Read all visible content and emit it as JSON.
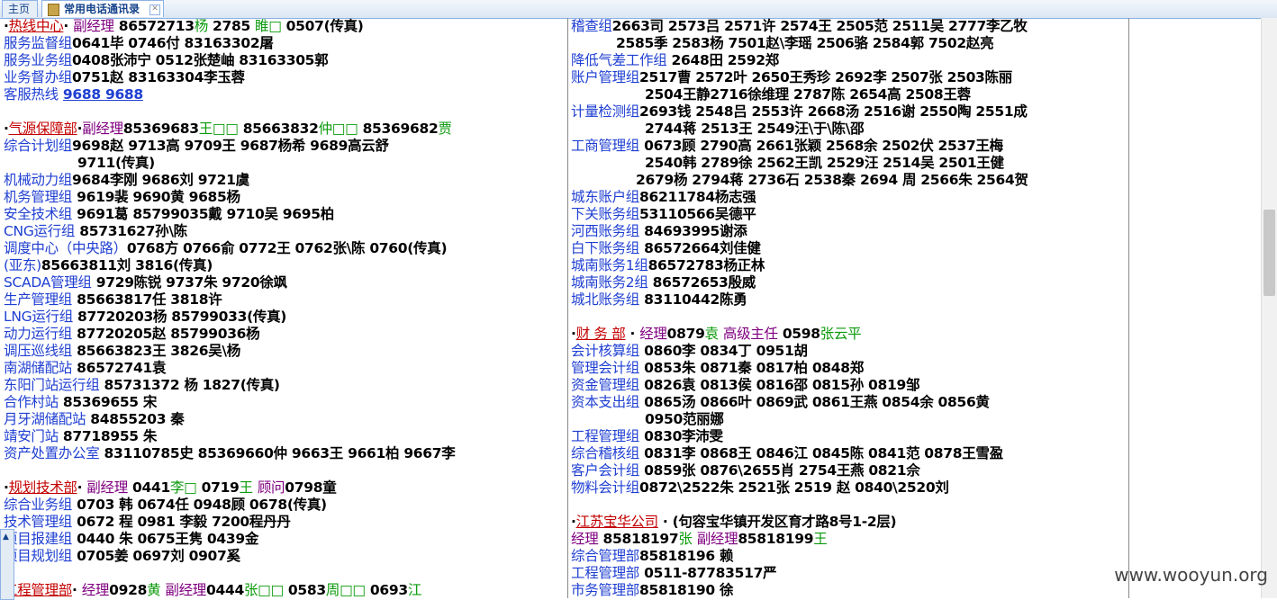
{
  "tabs": {
    "home": "主页",
    "active": "常用电话通讯录"
  },
  "left": [
    {
      "parts": [
        [
          "t",
          "·"
        ],
        [
          "sec",
          "热线中心"
        ],
        [
          "t",
          "·  "
        ],
        [
          "role",
          "副经理"
        ],
        [
          "t",
          " 86572713"
        ],
        [
          "g",
          "杨"
        ],
        [
          "t",
          "  2785 "
        ],
        [
          "g",
          "睢□"
        ],
        [
          "t",
          " 0507(传真)"
        ]
      ]
    },
    {
      "parts": [
        [
          "lbl",
          "服务监督组"
        ],
        [
          "t",
          "0641毕 0746付 83163302屠"
        ]
      ]
    },
    {
      "parts": [
        [
          "lbl",
          "服务业务组"
        ],
        [
          "t",
          "0408张沛宁 0512张楚岫  83163305郭"
        ]
      ]
    },
    {
      "parts": [
        [
          "lbl",
          "业务督办组"
        ],
        [
          "t",
          "0751赵  83163304李玉蓉"
        ]
      ]
    },
    {
      "parts": [
        [
          "lbl",
          "客服热线"
        ],
        [
          "t",
          "  "
        ],
        [
          "hl",
          "9688 9688"
        ]
      ]
    },
    {
      "gap": true
    },
    {
      "parts": [
        [
          "t",
          "·"
        ],
        [
          "sec",
          "气源保障部"
        ],
        [
          "t",
          "·"
        ],
        [
          "role",
          "副经理"
        ],
        [
          "t",
          "85369683"
        ],
        [
          "g",
          "王□□"
        ],
        [
          "t",
          " 85663832"
        ],
        [
          "g",
          "仲□□"
        ],
        [
          "t",
          " 85369682"
        ],
        [
          "g",
          "贾"
        ]
      ]
    },
    {
      "parts": [
        [
          "lbl",
          "综合计划组"
        ],
        [
          "t",
          "9698赵 9713高 9709王 9687杨希 9689高云舒"
        ]
      ]
    },
    {
      "indent": 1,
      "parts": [
        [
          "t",
          "9711(传真)"
        ]
      ]
    },
    {
      "parts": [
        [
          "lbl",
          "机械动力组"
        ],
        [
          "t",
          "9684李刚 9686刘 9721虞"
        ]
      ]
    },
    {
      "parts": [
        [
          "lbl",
          "机务管理组"
        ],
        [
          "t",
          " 9619裴 9690黄   9685杨"
        ]
      ]
    },
    {
      "parts": [
        [
          "lbl",
          "安全技术组"
        ],
        [
          "t",
          " 9691葛 85799035戴 9710吴 9695柏"
        ]
      ]
    },
    {
      "parts": [
        [
          "lbl",
          "CNG运行组"
        ],
        [
          "t",
          " 85731627孙\\陈"
        ]
      ]
    },
    {
      "parts": [
        [
          "lbl",
          "调度中心（中央路）"
        ],
        [
          "t",
          "0768方 0766俞 0772王 0762张\\陈  0760(传真)"
        ]
      ]
    },
    {
      "parts": [
        [
          "lbl",
          "(亚东)"
        ],
        [
          "t",
          "85663811刘 3816(传真)"
        ]
      ]
    },
    {
      "parts": [
        [
          "lbl",
          "SCADA管理组"
        ],
        [
          "t",
          " 9729陈锐 9737朱 9720徐飒"
        ]
      ]
    },
    {
      "parts": [
        [
          "lbl",
          "生产管理组"
        ],
        [
          "t",
          " 85663817任 3818许"
        ]
      ]
    },
    {
      "parts": [
        [
          "lbl",
          "LNG运行组"
        ],
        [
          "t",
          " 87720203杨 85799033(传真)"
        ]
      ]
    },
    {
      "parts": [
        [
          "lbl",
          "动力运行组"
        ],
        [
          "t",
          " 87720205赵 85799036杨"
        ]
      ]
    },
    {
      "parts": [
        [
          "lbl",
          "调压巡线组"
        ],
        [
          "t",
          " 85663823王 3826吴\\杨"
        ]
      ]
    },
    {
      "parts": [
        [
          "lbl",
          "南湖储配站"
        ],
        [
          "t",
          " 86572741袁"
        ]
      ]
    },
    {
      "parts": [
        [
          "lbl",
          "东阳门站运行组"
        ],
        [
          "t",
          " 85731372 杨 1827(传真)"
        ]
      ]
    },
    {
      "parts": [
        [
          "lbl",
          "合作村站"
        ],
        [
          "t",
          " 85369655 宋"
        ]
      ]
    },
    {
      "parts": [
        [
          "lbl",
          "月牙湖储配站"
        ],
        [
          "t",
          " 84855203 秦"
        ]
      ]
    },
    {
      "parts": [
        [
          "lbl",
          "靖安门站"
        ],
        [
          "t",
          " 87718955 朱"
        ]
      ]
    },
    {
      "parts": [
        [
          "lbl",
          "资产处置办公室"
        ],
        [
          "t",
          " 83110785史 85369660仲 9663王 9661柏 9667李"
        ]
      ]
    },
    {
      "gap": true
    },
    {
      "parts": [
        [
          "t",
          "·"
        ],
        [
          "sec",
          "规划技术部"
        ],
        [
          "t",
          "·    "
        ],
        [
          "role",
          "副经理"
        ],
        [
          "t",
          " 0441"
        ],
        [
          "g",
          "李□"
        ],
        [
          "t",
          "  0719"
        ],
        [
          "g",
          "王"
        ],
        [
          "t",
          "   "
        ],
        [
          "role",
          "顾问"
        ],
        [
          "t",
          "0798童"
        ]
      ]
    },
    {
      "parts": [
        [
          "lbl",
          "综合业务组"
        ],
        [
          "t",
          " 0703 韩  0674任 0948顾  0678(传真)"
        ]
      ]
    },
    {
      "parts": [
        [
          "lbl",
          "技术管理组"
        ],
        [
          "t",
          " 0672 程  0981 李毅  7200程丹丹"
        ]
      ]
    },
    {
      "parts": [
        [
          "lbl",
          "项目报建组"
        ],
        [
          "t",
          "  0440 朱  0675王隽  0439金"
        ]
      ]
    },
    {
      "parts": [
        [
          "lbl",
          "项目规划组"
        ],
        [
          "t",
          " 0705姜  0697刘  0907奚"
        ]
      ]
    },
    {
      "gap": true
    },
    {
      "parts": [
        [
          "sec",
          "工程管理部"
        ],
        [
          "t",
          "· "
        ],
        [
          "role",
          "经理"
        ],
        [
          "t",
          "0928"
        ],
        [
          "g",
          "黄"
        ],
        [
          "t",
          "  "
        ],
        [
          "role",
          "副经理"
        ],
        [
          "t",
          "0444"
        ],
        [
          "g",
          "张□□"
        ],
        [
          "t",
          " 0583"
        ],
        [
          "g",
          "周□□"
        ],
        [
          "t",
          " 0693"
        ],
        [
          "g",
          "江"
        ]
      ]
    }
  ],
  "right": [
    {
      "parts": [
        [
          "lbl",
          "稽查组"
        ],
        [
          "t",
          "2663司 2573吕 2571许 2574王  2505范  2511吴  2777李乙牧"
        ]
      ]
    },
    {
      "indent": 2,
      "parts": [
        [
          "t",
          "2585季  2583杨 7501赵\\李瑶  2506骆  2584郭  7502赵亮"
        ]
      ]
    },
    {
      "parts": [
        [
          "lbl",
          "降低气差工作组"
        ],
        [
          "t",
          " 2648田  2592郑"
        ]
      ]
    },
    {
      "parts": [
        [
          "lbl",
          "账户管理组"
        ],
        [
          "t",
          "2517曹 2572叶 2650王秀珍  2692李 2507张 2503陈丽"
        ]
      ]
    },
    {
      "indent": 1,
      "parts": [
        [
          "t",
          "2504王静2716徐维理  2787陈  2654高  2508王蓉"
        ]
      ]
    },
    {
      "parts": [
        [
          "lbl",
          "计量检测组"
        ],
        [
          "t",
          "2693钱 2548吕 2553许  2668汤  2516谢 2550陶  2551成"
        ]
      ]
    },
    {
      "indent": 1,
      "parts": [
        [
          "t",
          "2744蒋  2513王  2549汪\\于\\陈\\邵"
        ]
      ]
    },
    {
      "parts": [
        [
          "lbl",
          "工商管理组"
        ],
        [
          "t",
          " 0673顾 2790高 2661张颖 2568余 2502伏 2537王梅"
        ]
      ]
    },
    {
      "indent": 1,
      "parts": [
        [
          "t",
          "2540韩  2789徐  2562王凯  2529汪  2514吴 2501王健"
        ]
      ]
    },
    {
      "indent": 3,
      "parts": [
        [
          "t",
          "2679杨  2794蒋  2736石  2538秦  2694 周 2566朱  2564贺"
        ]
      ]
    },
    {
      "parts": [
        [
          "lbl",
          "城东账户组"
        ],
        [
          "t",
          "86211784杨志强"
        ]
      ]
    },
    {
      "parts": [
        [
          "lbl",
          "下关账务组"
        ],
        [
          "t",
          "53110566吴德平"
        ]
      ]
    },
    {
      "parts": [
        [
          "lbl",
          "河西账务组"
        ],
        [
          "t",
          "  84693995谢添"
        ]
      ]
    },
    {
      "parts": [
        [
          "lbl",
          "白下账务组"
        ],
        [
          "t",
          "  86572664刘佳健"
        ]
      ]
    },
    {
      "parts": [
        [
          "lbl",
          "城南账务1组"
        ],
        [
          "t",
          "86572783杨正林"
        ]
      ]
    },
    {
      "parts": [
        [
          "lbl",
          "城南账务2组"
        ],
        [
          "t",
          "  86572653殷威"
        ]
      ]
    },
    {
      "parts": [
        [
          "lbl",
          "城北账务组"
        ],
        [
          "t",
          "  83110442陈勇"
        ]
      ]
    },
    {
      "gap": true
    },
    {
      "parts": [
        [
          "t",
          " ·"
        ],
        [
          "sec",
          "财 务 部"
        ],
        [
          "t",
          " · "
        ],
        [
          "role",
          "经理"
        ],
        [
          "t",
          "0879"
        ],
        [
          "g",
          "袁"
        ],
        [
          "t",
          "  "
        ],
        [
          "role",
          "高级主任"
        ],
        [
          "t",
          " 0598"
        ],
        [
          "g",
          "张云平"
        ]
      ]
    },
    {
      "parts": [
        [
          "lbl",
          "会计核算组"
        ],
        [
          "t",
          "  0860李  0834丁  0951胡"
        ]
      ]
    },
    {
      "parts": [
        [
          "lbl",
          "管理会计组"
        ],
        [
          "t",
          "  0853朱  0871秦  0817柏  0848郑"
        ]
      ]
    },
    {
      "parts": [
        [
          "lbl",
          "资金管理组"
        ],
        [
          "t",
          "  0826袁  0813侯  0816邵 0815孙 0819邹"
        ]
      ]
    },
    {
      "parts": [
        [
          "lbl",
          "资本支出组"
        ],
        [
          "t",
          "  0865汤  0866叶 0869武  0861王燕  0854余 0856黄"
        ]
      ]
    },
    {
      "indent": 1,
      "parts": [
        [
          "t",
          "0950范丽娜"
        ]
      ]
    },
    {
      "parts": [
        [
          "lbl",
          "工程管理组"
        ],
        [
          "t",
          "  0830李沛雯"
        ]
      ]
    },
    {
      "parts": [
        [
          "lbl",
          "综合稽核组"
        ],
        [
          "t",
          "  0831李 0868王 0846江 0845陈  0841范 0878王雪盈"
        ]
      ]
    },
    {
      "parts": [
        [
          "lbl",
          "客户会计组"
        ],
        [
          "t",
          "  0859张 0876\\2655肖 2754王燕 0821佘"
        ]
      ]
    },
    {
      "parts": [
        [
          "lbl",
          "物料会计组"
        ],
        [
          "t",
          "0872\\2522朱 2521张 2519 赵 0840\\2520刘"
        ]
      ]
    },
    {
      "gap": true
    },
    {
      "parts": [
        [
          "t",
          " ·"
        ],
        [
          "sec",
          "江苏宝华公司"
        ],
        [
          "t",
          " · (句容宝华镇开发区育才路8号1-2层)"
        ]
      ]
    },
    {
      "parts": [
        [
          "role",
          "经理"
        ],
        [
          "t",
          " 85818197"
        ],
        [
          "g",
          "张"
        ],
        [
          "t",
          "   "
        ],
        [
          "role",
          "副经理"
        ],
        [
          "t",
          "85818199"
        ],
        [
          "g",
          "王"
        ]
      ]
    },
    {
      "parts": [
        [
          "lbl",
          "综合管理部"
        ],
        [
          "t",
          "85818196 赖"
        ]
      ]
    },
    {
      "parts": [
        [
          "lbl",
          "工程管理部"
        ],
        [
          "t",
          " 0511-87783517严"
        ]
      ]
    },
    {
      "parts": [
        [
          "lbl",
          "市务管理部"
        ],
        [
          "t",
          "85818190 徐"
        ]
      ]
    }
  ],
  "watermark": "www.wooyun.org"
}
